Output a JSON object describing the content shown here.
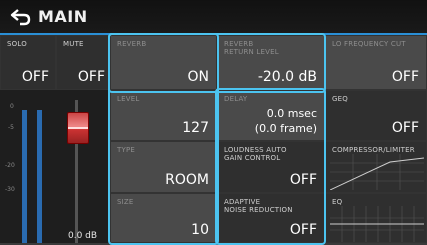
{
  "header": {
    "title": "MAIN",
    "back_icon": "back-arrow-icon"
  },
  "accent_color": "#4cc4f0",
  "cells": {
    "solo": {
      "label": "SOLO",
      "value": "OFF"
    },
    "mute": {
      "label": "MUTE",
      "value": "OFF"
    },
    "reverb": {
      "label": "REVERB",
      "value": "ON"
    },
    "reverb_return_level": {
      "label_line1": "REVERB",
      "label_line2": "RETURN LEVEL",
      "value": "-20.0 dB"
    },
    "lo_frequency_cut": {
      "label": "LO FREQUENCY CUT",
      "value": "OFF"
    },
    "level": {
      "label": "LEVEL",
      "value": "127"
    },
    "delay": {
      "label": "DELAY",
      "value_line1": "0.0 msec",
      "value_line2": "(0.0 frame)"
    },
    "geq": {
      "label": "GEQ",
      "value": "OFF"
    },
    "type": {
      "label": "TYPE",
      "value": "ROOM"
    },
    "loudness_auto_gain_control": {
      "label_line1": "LOUDNESS AUTO",
      "label_line2": "GAIN CONTROL",
      "value": "OFF"
    },
    "compressor_limiter": {
      "label": "COMPRESSOR/LIMITER"
    },
    "size": {
      "label": "SIZE",
      "value": "10"
    },
    "adaptive_noise_reduction": {
      "label_line1": "ADAPTIVE",
      "label_line2": "NOISE REDUCTION",
      "value": "OFF"
    },
    "eq": {
      "label": "EQ"
    }
  },
  "fader": {
    "value_text": "0.0 dB",
    "scale": [
      "0",
      "-5",
      "-20",
      "-30"
    ]
  }
}
